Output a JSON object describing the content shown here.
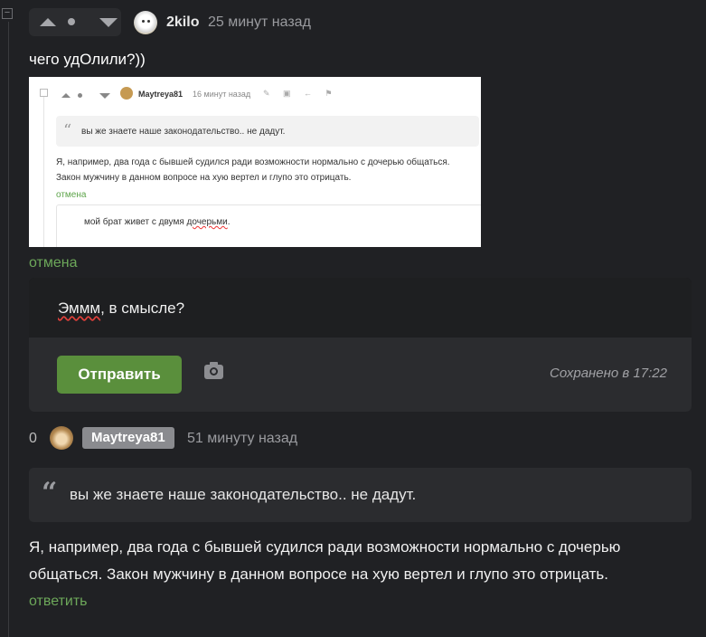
{
  "comment1": {
    "collapse_symbol": "−",
    "username": "2kilo",
    "time": "25 минут назад",
    "text": "чего удОлили?))",
    "screenshot": {
      "username": "Maytreya81",
      "time": "16 минут назад",
      "quote": "вы же знаете наше законодательство.. не дадут.",
      "body_line1": "Я, например, два года с бывшей судился ради возможности нормально с дочерью общаться.",
      "body_line2": "Закон мужчину в данном вопросе на хую вертел и глупо это отрицать.",
      "cancel": "отмена",
      "reply_before": "мой брат живет с двумя ",
      "reply_underlined": "дочерьми",
      "reply_after": "."
    },
    "cancel_label": "отмена"
  },
  "reply_form": {
    "text_spellchecked": "Эммм",
    "text_rest": ", в смысле?",
    "send_label": "Отправить",
    "camera_icon": "camera-icon",
    "saved_status": "Сохранено в 17:22"
  },
  "comment2": {
    "score": "0",
    "username": "Maytreya81",
    "time": "51 минуту назад",
    "quote": "вы же знаете наше законодательство.. не дадут.",
    "quote_icon": "“",
    "body": "Я, например, два года с бывшей судился ради возможности нормально с дочерью общаться. Закон мужчину в данном вопросе на хую вертел и глупо это отрицать.",
    "reply_label": "ответить"
  },
  "colors": {
    "background": "#202124",
    "accent_green": "#5a8f3c",
    "link_green": "#6da85a",
    "panel": "#2b2c2f"
  }
}
